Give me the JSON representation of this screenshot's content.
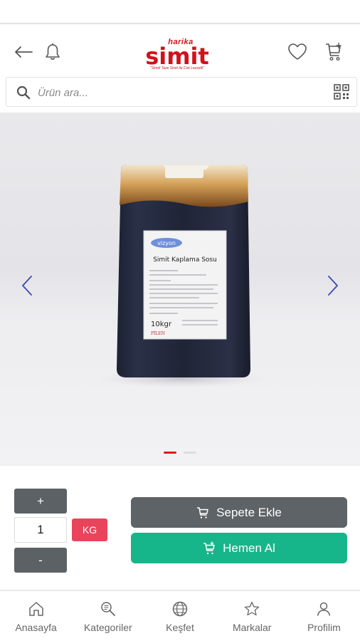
{
  "header": {
    "back_icon": "arrow-left-icon",
    "bell_icon": "bell-icon",
    "favorite_icon": "heart-icon",
    "cart_icon": "cart-icon",
    "logo": {
      "small_text": "harika",
      "main_text": "simit",
      "tagline": "\"Simdi Taze Simit Ile Cok Lezzetli\""
    }
  },
  "search": {
    "placeholder": "Ürün ara...",
    "search_icon": "search-icon",
    "qr_icon": "qr-code-icon"
  },
  "product": {
    "image": {
      "brand_label": "vizyon",
      "product_label": "Simit Kaplama Sosu",
      "weight_label": "10kgr",
      "producer_label": "PİLEN"
    },
    "slide_count": 2,
    "active_slide": 1
  },
  "order": {
    "plus_label": "+",
    "minus_label": "-",
    "quantity": "1",
    "unit": "KG",
    "add_to_cart_label": "Sepete Ekle",
    "buy_now_label": "Hemen Al"
  },
  "colors": {
    "brand_red": "#d0121b",
    "dark_button": "#5e6367",
    "green_button": "#17b58a",
    "unit_badge": "#e8455c",
    "arrow_blue": "#4651b8",
    "dot_active": "#e0161f",
    "dot_inactive": "#dddddd"
  },
  "bottom_nav": {
    "items": [
      {
        "label": "Anasayfa",
        "icon": "home-icon"
      },
      {
        "label": "Kategoriler",
        "icon": "category-search-icon"
      },
      {
        "label": "Keşfet",
        "icon": "globe-icon"
      },
      {
        "label": "Markalar",
        "icon": "star-icon"
      },
      {
        "label": "Profilim",
        "icon": "user-icon"
      }
    ]
  }
}
